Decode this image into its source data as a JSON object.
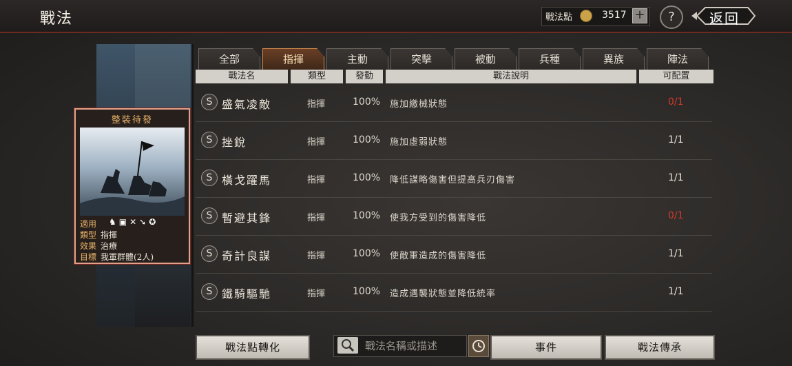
{
  "header": {
    "title": "戰法",
    "points_label": "戰法點",
    "points_value": "3517",
    "plus": "+",
    "help": "?",
    "return_label": "返回"
  },
  "tabs": [
    "全部",
    "指揮",
    "主動",
    "突擊",
    "被動",
    "兵種",
    "異族",
    "陣法"
  ],
  "active_tab": "指揮",
  "columns": [
    "戰法名",
    "類型",
    "發動",
    "戰法說明",
    "可配置"
  ],
  "card": {
    "title": "整裝待發",
    "rows": [
      {
        "key": "適用",
        "value": ""
      },
      {
        "key": "類型",
        "value": "指揮"
      },
      {
        "key": "效果",
        "value": "治療"
      },
      {
        "key": "目標",
        "value": "我軍群體(2人)"
      }
    ]
  },
  "rows": [
    {
      "grade": "S",
      "name": "盛氣凌敵",
      "type": "指揮",
      "rate": "100%",
      "desc": "施加繳械狀態",
      "avail": "0/1",
      "avail_color": "#d23b2a"
    },
    {
      "grade": "S",
      "name": "挫銳",
      "type": "指揮",
      "rate": "100%",
      "desc": "施加虛弱狀態",
      "avail": "1/1",
      "avail_color": "#e8e2d6"
    },
    {
      "grade": "S",
      "name": "橫戈躍馬",
      "type": "指揮",
      "rate": "100%",
      "desc": "降低謀略傷害但提高兵刃傷害",
      "avail": "1/1",
      "avail_color": "#e8e2d6"
    },
    {
      "grade": "S",
      "name": "暫避其鋒",
      "type": "指揮",
      "rate": "100%",
      "desc": "使我方受到的傷害降低",
      "avail": "0/1",
      "avail_color": "#d23b2a"
    },
    {
      "grade": "S",
      "name": "奇計良謀",
      "type": "指揮",
      "rate": "100%",
      "desc": "使敵軍造成的傷害降低",
      "avail": "1/1",
      "avail_color": "#e8e2d6"
    },
    {
      "grade": "S",
      "name": "鐵騎驅馳",
      "type": "指揮",
      "rate": "100%",
      "desc": "造成遇襲狀態並降低統率",
      "avail": "1/1",
      "avail_color": "#e8e2d6"
    }
  ],
  "bottom": {
    "convert": "戰法點轉化",
    "search_placeholder": "戰法名稱或描述",
    "events": "事件",
    "inherit": "戰法傳承"
  }
}
